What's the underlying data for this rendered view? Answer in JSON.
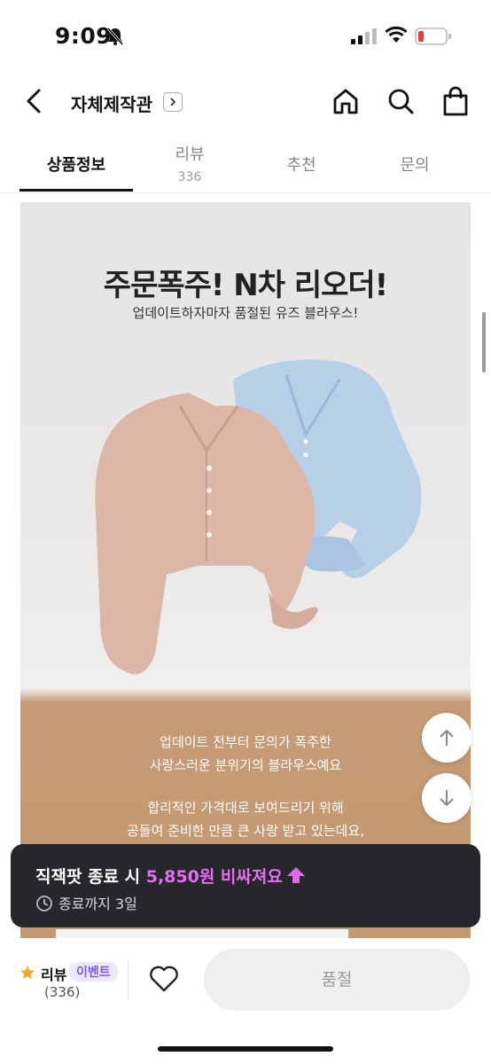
{
  "status": {
    "time": "9:09"
  },
  "header": {
    "store_name": "자체제작관"
  },
  "tabs": [
    {
      "label": "상품정보",
      "count": ""
    },
    {
      "label": "리뷰",
      "count": "336"
    },
    {
      "label": "추천",
      "count": ""
    },
    {
      "label": "문의",
      "count": ""
    }
  ],
  "product": {
    "headline": "주문폭주! N차 리오더!",
    "subline": "업데이트하자마자 품절된 유즈 블라우스!",
    "desc1": "업데이트 전부터 문의가 폭주한",
    "desc2": "사랑스러운 분위기의 블라우스예요",
    "desc3": "합리적인 가격대로 보여드리기 위해",
    "desc4": "공들여 준비한 만큼 큰 사랑 받고 있는데요,"
  },
  "toast": {
    "title_prefix": "직잭팟 종료 시 ",
    "title_price": "5,850원 비싸져요",
    "subtitle": "종료까지 3일"
  },
  "bottom": {
    "review_label": "리뷰",
    "event_badge": "이벤트",
    "review_count": "(336)",
    "soldout_label": "품절"
  },
  "colors": {
    "accent_purple": "#e46df2",
    "toast_bg": "#26272b",
    "star": "#f4a925"
  }
}
